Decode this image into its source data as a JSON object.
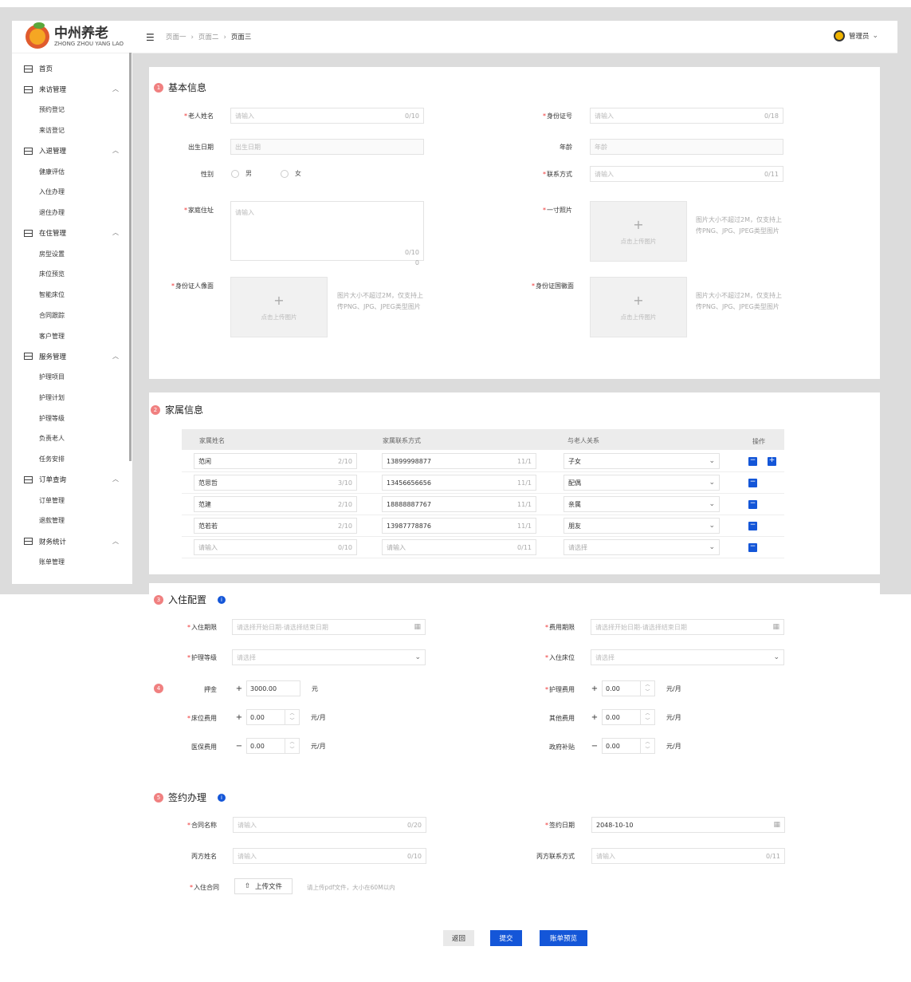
{
  "app": {
    "logo_title": "中州养老",
    "logo_sub": "ZHONG ZHOU YANG LAO"
  },
  "breadcrumb": [
    "页面一",
    "页面二",
    "页面三"
  ],
  "user": {
    "name": "管理员"
  },
  "sidebar": [
    {
      "label": "首页",
      "children": []
    },
    {
      "label": "来访管理",
      "children": [
        "预约登记",
        "来访登记"
      ]
    },
    {
      "label": "入退管理",
      "children": [
        "健康评估",
        "入住办理",
        "退住办理"
      ]
    },
    {
      "label": "在住管理",
      "children": [
        "房型设置",
        "床位预览",
        "智能床位",
        "合同跟踪",
        "客户管理"
      ]
    },
    {
      "label": "服务管理",
      "children": [
        "护理项目",
        "护理计划",
        "护理等级",
        "负责老人",
        "任务安排"
      ]
    },
    {
      "label": "订单查询",
      "children": [
        "订单管理",
        "退款管理"
      ]
    },
    {
      "label": "财务统计",
      "children": [
        "账单管理"
      ]
    }
  ],
  "basic": {
    "title": "基本信息",
    "num": "1",
    "name_label": "老人姓名",
    "name_ph": "请输入",
    "name_cnt": "0/10",
    "id_label": "身份证号",
    "id_ph": "请输入",
    "id_cnt": "0/18",
    "birth_label": "出生日期",
    "birth_ph": "出生日期",
    "age_label": "年龄",
    "age_ph": "年龄",
    "gender_label": "性别",
    "male": "男",
    "female": "女",
    "contact_label": "联系方式",
    "contact_ph": "请输入",
    "contact_cnt": "0/11",
    "addr_label": "家庭住址",
    "addr_ph": "请输入",
    "addr_cnt": "0/10",
    "addr_cnt2": "0",
    "photo_label": "一寸照片",
    "upload_text": "点击上传图片",
    "hint": "图片大小不超过2M，仅支持上传PNG、JPG、JPEG类型图片",
    "idfront_label": "身份证人像面",
    "idback_label": "身份证国徽面"
  },
  "family": {
    "title": "家属信息",
    "num": "2",
    "headers": [
      "家属姓名",
      "家属联系方式",
      "与老人关系",
      "操作"
    ],
    "rows": [
      {
        "name": "范闲",
        "name_cnt": "2/10",
        "phone": "13899998877",
        "phone_cnt": "11/1",
        "rel": "子女"
      },
      {
        "name": "范思哲",
        "name_cnt": "3/10",
        "phone": "13456656656",
        "phone_cnt": "11/1",
        "rel": "配偶"
      },
      {
        "name": "范建",
        "name_cnt": "2/10",
        "phone": "18888887767",
        "phone_cnt": "11/1",
        "rel": "亲属"
      },
      {
        "name": "范若若",
        "name_cnt": "2/10",
        "phone": "13987778876",
        "phone_cnt": "11/1",
        "rel": "朋友"
      }
    ],
    "empty": {
      "name_ph": "请输入",
      "name_cnt": "0/10",
      "phone_ph": "请输入",
      "phone_cnt": "0/11",
      "rel_ph": "请选择"
    },
    "minus": "−",
    "plus": "+"
  },
  "checkin": {
    "title": "入住配置",
    "num": "3",
    "num2": "4",
    "period_label": "入住期限",
    "period_ph": "请选择开始日期-请选择结束日期",
    "fee_period_label": "费用期限",
    "fee_period_ph": "请选择开始日期-请选择结束日期",
    "level_label": "护理等级",
    "level_ph": "请选择",
    "bed_label": "入住床位",
    "bed_ph": "请选择",
    "deposit_label": "押金",
    "deposit_sign": "+",
    "deposit": "3000.00",
    "deposit_unit": "元",
    "nursing_label": "护理费用",
    "nursing_sign": "+",
    "nursing": "0.00",
    "nursing_unit": "元/月",
    "bedfee_label": "床位费用",
    "bedfee_sign": "+",
    "bedfee": "0.00",
    "bedfee_unit": "元/月",
    "other_label": "其他费用",
    "other_sign": "+",
    "other": "0.00",
    "other_unit": "元/月",
    "medical_label": "医保费用",
    "medical_sign": "−",
    "medical": "0.00",
    "medical_unit": "元/月",
    "gov_label": "政府补贴",
    "gov_sign": "−",
    "gov": "0.00",
    "gov_unit": "元/月"
  },
  "contract": {
    "title": "签约办理",
    "num": "5",
    "name_label": "合同名称",
    "name_ph": "请输入",
    "name_cnt": "0/20",
    "date_label": "签约日期",
    "date": "2048-10-10",
    "party_label": "丙方姓名",
    "party_ph": "请输入",
    "party_cnt": "0/10",
    "party_contact_label": "丙方联系方式",
    "party_contact_ph": "请输入",
    "party_contact_cnt": "0/11",
    "file_label": "入住合同",
    "upload_btn": "上传文件",
    "upload_hint": "请上传pdf文件，大小在60M以内"
  },
  "actions": {
    "back": "返回",
    "submit": "提交",
    "preview": "账单预览"
  },
  "colors": {
    "primary": "#1456d8",
    "step": "#f08080",
    "required": "#ee3333"
  }
}
